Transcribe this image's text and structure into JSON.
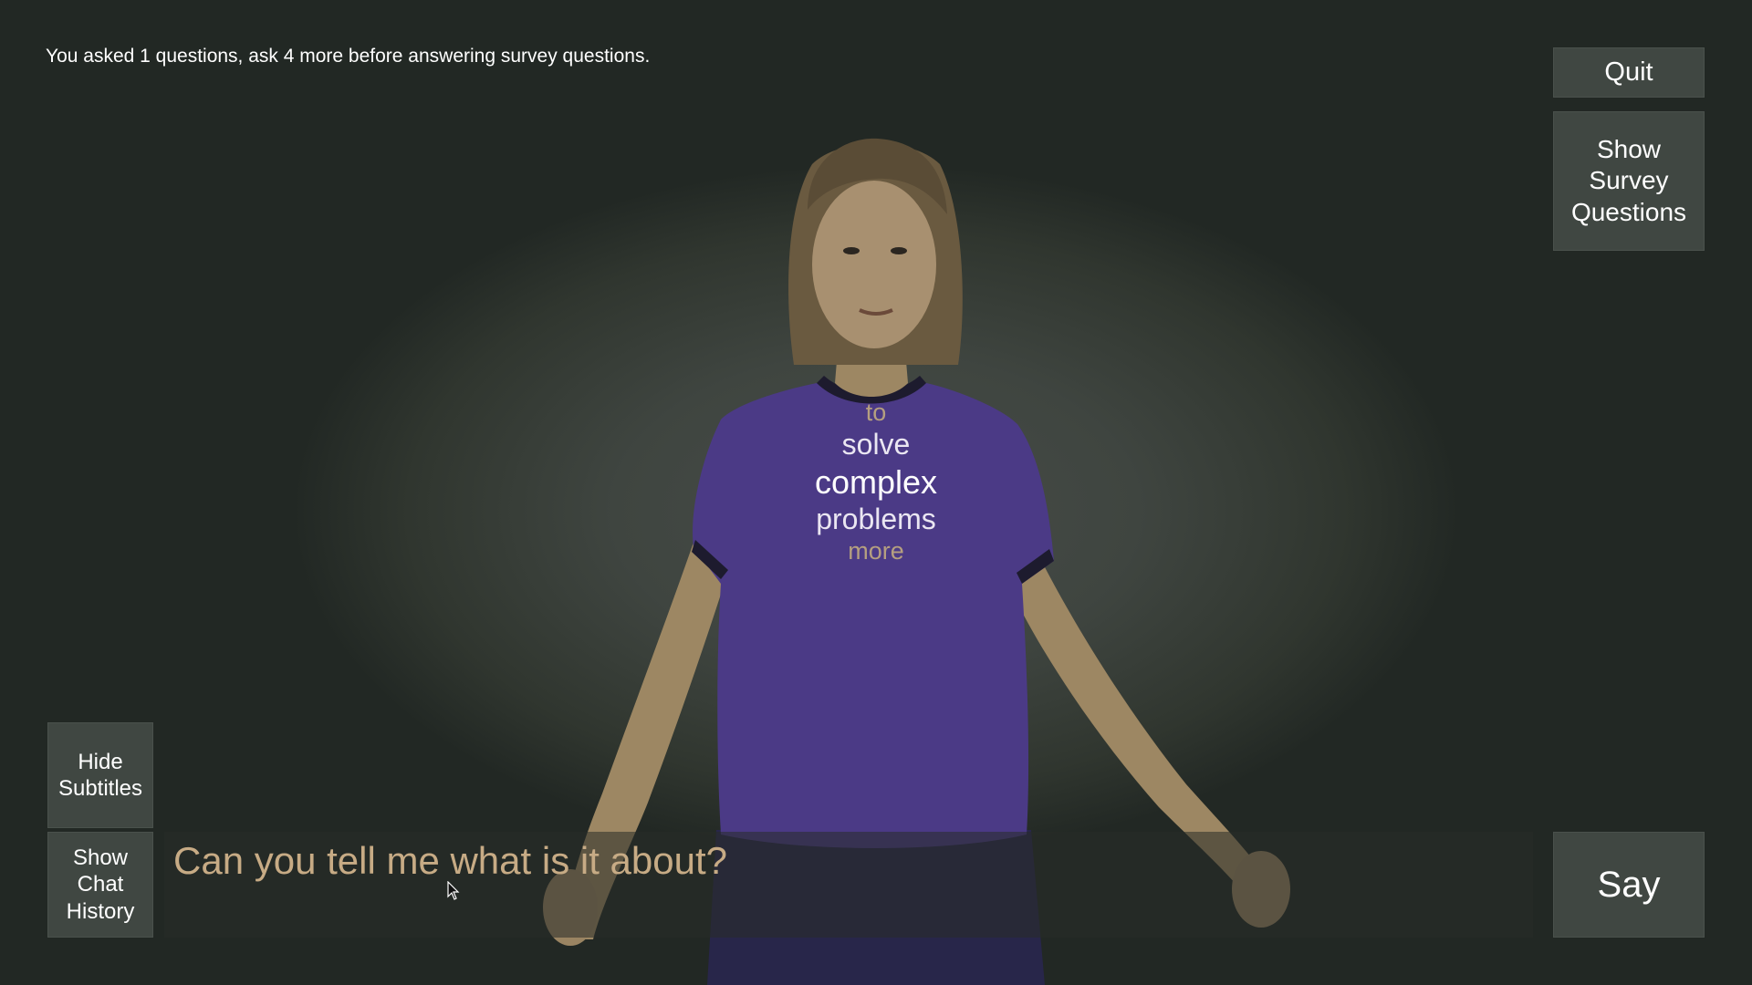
{
  "status": {
    "message": "You asked 1 questions, ask 4 more before answering survey questions."
  },
  "buttons": {
    "quit": "Quit",
    "show_survey_questions": "Show\nSurvey\nQuestions",
    "hide_subtitles": "Hide\nSubtitles",
    "show_chat_history": "Show\nChat\nHistory",
    "say": "Say"
  },
  "subtitles": {
    "words": [
      "to",
      "solve",
      "complex",
      "problems",
      "more"
    ]
  },
  "input": {
    "value": "Can you tell me what is it about?"
  },
  "colors": {
    "background": "#3f4540",
    "button": "#404742",
    "shirt": "#4b3a86",
    "skin": "#a08a66",
    "input_text": "#c7ab85"
  },
  "icons": {
    "cursor": "mouse-pointer-icon"
  }
}
